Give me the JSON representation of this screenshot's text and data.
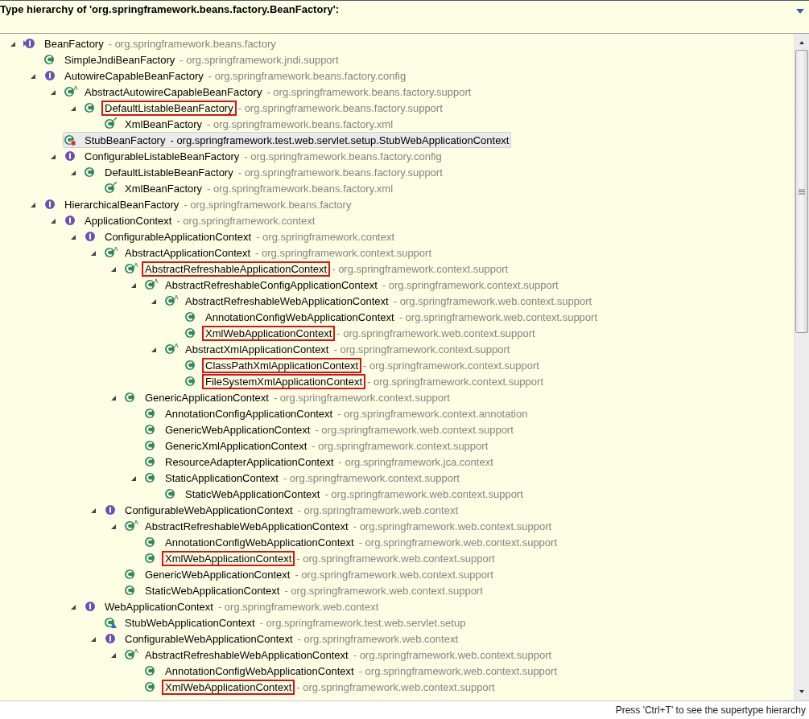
{
  "header": {
    "title": "Type hierarchy of 'org.springframework.beans.factory.BeanFactory':"
  },
  "tree": [
    {
      "name": "BeanFactory",
      "package": "- org.springframework.beans.factory",
      "kind": "focus-interface",
      "expanded": true,
      "selected": false,
      "highlighted": false,
      "children": [
        {
          "name": "SimpleJndiBeanFactory",
          "package": "- org.springframework.jndi.support",
          "kind": "class",
          "selected": false,
          "highlighted": false
        },
        {
          "name": "AutowireCapableBeanFactory",
          "package": "- org.springframework.beans.factory.config",
          "kind": "interface",
          "expanded": true,
          "selected": false,
          "highlighted": false,
          "children": [
            {
              "name": "AbstractAutowireCapableBeanFactory",
              "package": "- org.springframework.beans.factory.support",
              "kind": "abstract-class",
              "expanded": true,
              "selected": false,
              "highlighted": false,
              "children": [
                {
                  "name": "DefaultListableBeanFactory",
                  "package": "- org.springframework.beans.factory.support",
                  "kind": "class",
                  "expanded": true,
                  "selected": false,
                  "highlighted": true,
                  "children": [
                    {
                      "name": "XmlBeanFactory",
                      "package": "- org.springframework.beans.factory.xml",
                      "kind": "deprecated-class",
                      "selected": false,
                      "highlighted": false
                    }
                  ]
                }
              ]
            },
            {
              "name": "StubBeanFactory",
              "package": "- org.springframework.test.web.servlet.setup.StubWebApplicationContext",
              "kind": "private-class",
              "selected": true,
              "highlighted": false
            },
            {
              "name": "ConfigurableListableBeanFactory",
              "package": "- org.springframework.beans.factory.config",
              "kind": "interface",
              "expanded": true,
              "selected": false,
              "highlighted": false,
              "children": [
                {
                  "name": "DefaultListableBeanFactory",
                  "package": "- org.springframework.beans.factory.support",
                  "kind": "class",
                  "expanded": true,
                  "selected": false,
                  "highlighted": false,
                  "children": [
                    {
                      "name": "XmlBeanFactory",
                      "package": "- org.springframework.beans.factory.xml",
                      "kind": "deprecated-class",
                      "selected": false,
                      "highlighted": false
                    }
                  ]
                }
              ]
            }
          ]
        },
        {
          "name": "HierarchicalBeanFactory",
          "package": "- org.springframework.beans.factory",
          "kind": "interface",
          "expanded": true,
          "selected": false,
          "highlighted": false,
          "children": [
            {
              "name": "ApplicationContext",
              "package": "- org.springframework.context",
              "kind": "interface",
              "expanded": true,
              "selected": false,
              "highlighted": false,
              "children": [
                {
                  "name": "ConfigurableApplicationContext",
                  "package": "- org.springframework.context",
                  "kind": "interface",
                  "expanded": true,
                  "selected": false,
                  "highlighted": false,
                  "children": [
                    {
                      "name": "AbstractApplicationContext",
                      "package": "- org.springframework.context.support",
                      "kind": "abstract-class",
                      "expanded": true,
                      "selected": false,
                      "highlighted": false,
                      "children": [
                        {
                          "name": "AbstractRefreshableApplicationContext",
                          "package": "- org.springframework.context.support",
                          "kind": "abstract-class",
                          "expanded": true,
                          "selected": false,
                          "highlighted": true,
                          "children": [
                            {
                              "name": "AbstractRefreshableConfigApplicationContext",
                              "package": "- org.springframework.context.support",
                              "kind": "abstract-class",
                              "expanded": true,
                              "selected": false,
                              "highlighted": false,
                              "children": [
                                {
                                  "name": "AbstractRefreshableWebApplicationContext",
                                  "package": "- org.springframework.web.context.support",
                                  "kind": "abstract-class",
                                  "expanded": true,
                                  "selected": false,
                                  "highlighted": false,
                                  "children": [
                                    {
                                      "name": "AnnotationConfigWebApplicationContext",
                                      "package": "- org.springframework.web.context.support",
                                      "kind": "class",
                                      "selected": false,
                                      "highlighted": false
                                    },
                                    {
                                      "name": "XmlWebApplicationContext",
                                      "package": "- org.springframework.web.context.support",
                                      "kind": "class",
                                      "selected": false,
                                      "highlighted": true
                                    }
                                  ]
                                },
                                {
                                  "name": "AbstractXmlApplicationContext",
                                  "package": "- org.springframework.context.support",
                                  "kind": "abstract-class",
                                  "expanded": true,
                                  "selected": false,
                                  "highlighted": false,
                                  "children": [
                                    {
                                      "name": "ClassPathXmlApplicationContext",
                                      "package": "- org.springframework.context.support",
                                      "kind": "class",
                                      "selected": false,
                                      "highlighted": true
                                    },
                                    {
                                      "name": "FileSystemXmlApplicationContext",
                                      "package": "- org.springframework.context.support",
                                      "kind": "class",
                                      "selected": false,
                                      "highlighted": true
                                    }
                                  ]
                                }
                              ]
                            }
                          ]
                        },
                        {
                          "name": "GenericApplicationContext",
                          "package": "- org.springframework.context.support",
                          "kind": "class",
                          "expanded": true,
                          "selected": false,
                          "highlighted": false,
                          "children": [
                            {
                              "name": "AnnotationConfigApplicationContext",
                              "package": "- org.springframework.context.annotation",
                              "kind": "class",
                              "selected": false,
                              "highlighted": false
                            },
                            {
                              "name": "GenericWebApplicationContext",
                              "package": "- org.springframework.web.context.support",
                              "kind": "class",
                              "selected": false,
                              "highlighted": false
                            },
                            {
                              "name": "GenericXmlApplicationContext",
                              "package": "- org.springframework.context.support",
                              "kind": "class",
                              "selected": false,
                              "highlighted": false
                            },
                            {
                              "name": "ResourceAdapterApplicationContext",
                              "package": "- org.springframework.jca.context",
                              "kind": "class",
                              "selected": false,
                              "highlighted": false
                            },
                            {
                              "name": "StaticApplicationContext",
                              "package": "- org.springframework.context.support",
                              "kind": "class",
                              "expanded": true,
                              "selected": false,
                              "highlighted": false,
                              "children": [
                                {
                                  "name": "StaticWebApplicationContext",
                                  "package": "- org.springframework.web.context.support",
                                  "kind": "class",
                                  "selected": false,
                                  "highlighted": false
                                }
                              ]
                            }
                          ]
                        }
                      ]
                    },
                    {
                      "name": "ConfigurableWebApplicationContext",
                      "package": "- org.springframework.web.context",
                      "kind": "interface",
                      "expanded": true,
                      "selected": false,
                      "highlighted": false,
                      "children": [
                        {
                          "name": "AbstractRefreshableWebApplicationContext",
                          "package": "- org.springframework.web.context.support",
                          "kind": "abstract-class",
                          "expanded": true,
                          "selected": false,
                          "highlighted": false,
                          "children": [
                            {
                              "name": "AnnotationConfigWebApplicationContext",
                              "package": "- org.springframework.web.context.support",
                              "kind": "class",
                              "selected": false,
                              "highlighted": false
                            },
                            {
                              "name": "XmlWebApplicationContext",
                              "package": "- org.springframework.web.context.support",
                              "kind": "class",
                              "selected": false,
                              "highlighted": true
                            }
                          ]
                        },
                        {
                          "name": "GenericWebApplicationContext",
                          "package": "- org.springframework.web.context.support",
                          "kind": "class",
                          "selected": false,
                          "highlighted": false
                        },
                        {
                          "name": "StaticWebApplicationContext",
                          "package": "- org.springframework.web.context.support",
                          "kind": "class",
                          "selected": false,
                          "highlighted": false
                        }
                      ]
                    }
                  ]
                },
                {
                  "name": "WebApplicationContext",
                  "package": "- org.springframework.web.context",
                  "kind": "interface",
                  "expanded": true,
                  "selected": false,
                  "highlighted": false,
                  "children": [
                    {
                      "name": "StubWebApplicationContext",
                      "package": "- org.springframework.test.web.servlet.setup",
                      "kind": "package-class",
                      "selected": false,
                      "highlighted": false
                    },
                    {
                      "name": "ConfigurableWebApplicationContext",
                      "package": "- org.springframework.web.context",
                      "kind": "interface",
                      "expanded": true,
                      "selected": false,
                      "highlighted": false,
                      "children": [
                        {
                          "name": "AbstractRefreshableWebApplicationContext",
                          "package": "- org.springframework.web.context.support",
                          "kind": "abstract-class",
                          "expanded": true,
                          "selected": false,
                          "highlighted": false,
                          "children": [
                            {
                              "name": "AnnotationConfigWebApplicationContext",
                              "package": "- org.springframework.web.context.support",
                              "kind": "class",
                              "selected": false,
                              "highlighted": false
                            },
                            {
                              "name": "XmlWebApplicationContext",
                              "package": "- org.springframework.web.context.support",
                              "kind": "class",
                              "selected": false,
                              "highlighted": true
                            }
                          ]
                        }
                      ]
                    }
                  ]
                }
              ]
            }
          ]
        }
      ]
    }
  ],
  "status_bar": {
    "hint": "Press 'Ctrl+T' to see the supertype hierarchy"
  }
}
